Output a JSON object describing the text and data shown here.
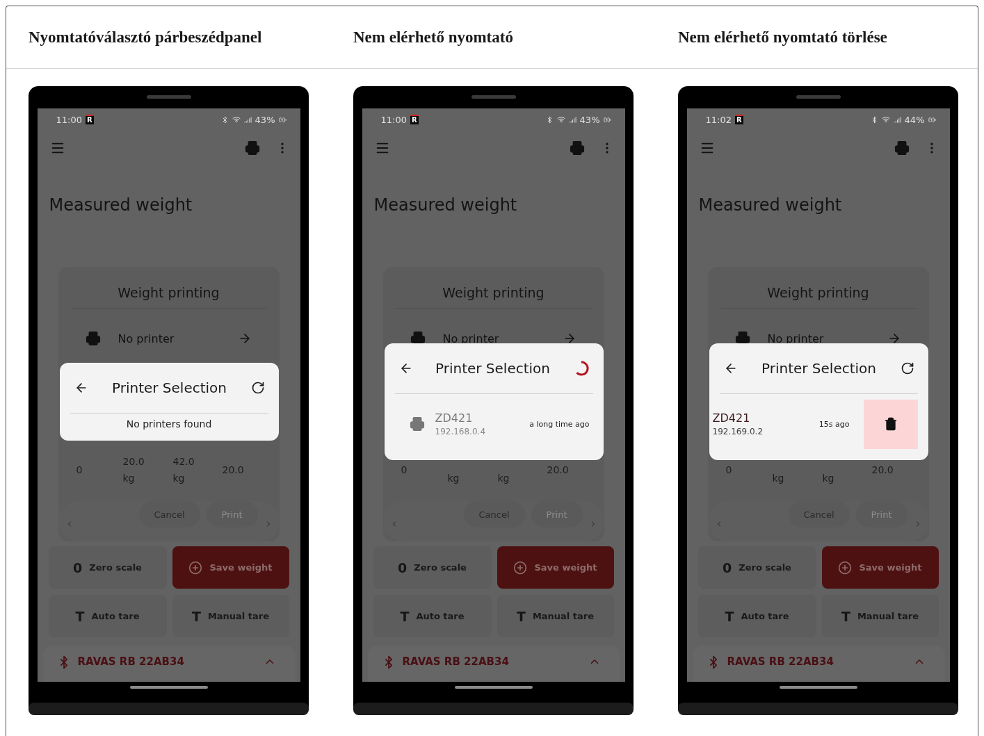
{
  "columns": [
    {
      "heading": "Nyomtatóválasztó párbeszédpanel",
      "phone": {
        "time": "11:00",
        "app_badge": "R",
        "battery": "43%",
        "title": "Measured weight",
        "card": {
          "title": "Weight printing",
          "printer": "No printer",
          "values": [
            {
              "text": "0"
            },
            {
              "text": "20.0 kg"
            },
            {
              "text": "42.0 kg"
            },
            {
              "text": "20.0"
            }
          ],
          "cancel": "Cancel",
          "print": "Print",
          "print_disabled": true
        },
        "actions": [
          {
            "kind": "plain",
            "glyph": "0",
            "label": "Zero scale"
          },
          {
            "kind": "primary",
            "label": "Save weight"
          },
          {
            "kind": "plain",
            "glyph": "T",
            "label": "Auto tare"
          },
          {
            "kind": "plain",
            "glyph": "T",
            "label": "Manual tare"
          }
        ],
        "device": "RAVAS RB 22AB34",
        "dialog": {
          "title": "Printer Selection",
          "loading": false,
          "message": "No printers found"
        }
      }
    },
    {
      "heading": "Nem elérhető nyomtató",
      "phone": {
        "time": "11:00",
        "app_badge": "R",
        "battery": "43%",
        "title": "Measured weight",
        "card": {
          "title": "Weight printing",
          "printer": "No printer",
          "values": [
            {
              "text": "0"
            },
            {
              "text": "kg",
              "covered_above": true
            },
            {
              "text": "kg",
              "covered_above": true
            },
            {
              "text": "20.0"
            }
          ],
          "cancel": "Cancel",
          "print": "Print",
          "print_disabled": true
        },
        "actions": [
          {
            "kind": "plain",
            "glyph": "0",
            "label": "Zero scale"
          },
          {
            "kind": "primary",
            "label": "Save weight"
          },
          {
            "kind": "plain",
            "glyph": "T",
            "label": "Auto tare"
          },
          {
            "kind": "plain",
            "glyph": "T",
            "label": "Manual tare"
          }
        ],
        "device": "RAVAS RB 22AB34",
        "dialog": {
          "title": "Printer Selection",
          "loading": true,
          "printers": [
            {
              "name": "ZD421",
              "address": "192.168.0.4",
              "last_seen": "a long time ago",
              "available": false,
              "swiped": false
            }
          ]
        }
      }
    },
    {
      "heading": "Nem elérhető nyomtató törlése",
      "phone": {
        "time": "11:02",
        "app_badge": "R",
        "battery": "44%",
        "title": "Measured weight",
        "card": {
          "title": "Weight printing",
          "printer": "No printer",
          "values": [
            {
              "text": "0"
            },
            {
              "text": "kg",
              "covered_above": true
            },
            {
              "text": "kg",
              "covered_above": true
            },
            {
              "text": "20.0"
            }
          ],
          "cancel": "Cancel",
          "print": "Print",
          "print_disabled": true
        },
        "actions": [
          {
            "kind": "plain",
            "glyph": "0",
            "label": "Zero scale"
          },
          {
            "kind": "primary",
            "label": "Save weight"
          },
          {
            "kind": "plain",
            "glyph": "T",
            "label": "Auto tare"
          },
          {
            "kind": "plain",
            "glyph": "T",
            "label": "Manual tare"
          }
        ],
        "device": "RAVAS RB 22AB34",
        "dialog": {
          "title": "Printer Selection",
          "loading": false,
          "printers": [
            {
              "name": "ZD421",
              "address": "192.169.0.2",
              "last_seen": "15s ago",
              "available": false,
              "swiped": true
            }
          ]
        }
      }
    }
  ]
}
